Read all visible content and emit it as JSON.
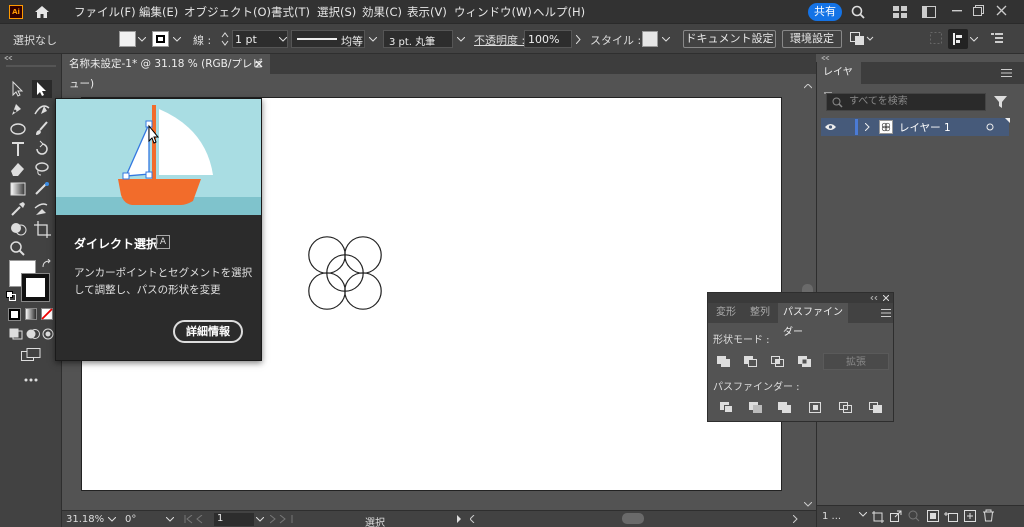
{
  "app": {
    "logo": "Ai"
  },
  "menu": [
    "ファイル(F)",
    "編集(E)",
    "オブジェクト(O)",
    "書式(T)",
    "選択(S)",
    "効果(C)",
    "表示(V)",
    "ウィンドウ(W)",
    "ヘルプ(H)"
  ],
  "share_label": "共有",
  "control": {
    "selection": "選択なし",
    "stroke_label": "線 :",
    "stroke_weight": "1 pt",
    "stroke_profile": "均等",
    "brush": "3 pt. 丸筆",
    "opacity_label": "不透明度 :",
    "opacity": "100%",
    "style_label": "スタイル :",
    "document_setup": "ドキュメント設定",
    "preferences": "環境設定"
  },
  "document_tab": "名称未設定-1* @ 31.18 % (RGB/プレビュー)",
  "tooltip": {
    "title": "ダイレクト選択",
    "shortcut": "A",
    "description": "アンカーポイントとセグメントを選択して調整し、パスの形状を変更",
    "more_button": "詳細情報"
  },
  "layers": {
    "tab": "レイヤー",
    "search_placeholder": "すべてを検索",
    "layer_name": "レイヤー 1",
    "footer_count": "1 ..."
  },
  "pathfinder": {
    "tabs": [
      "変形",
      "整列",
      "パスファインダー"
    ],
    "shape_modes_label": "形状モード :",
    "expand_label": "拡張",
    "pathfinders_label": "パスファインダー :"
  },
  "status": {
    "zoom": "31.18%",
    "rotation": "0°",
    "artboard_number": "1",
    "tool": "選択"
  },
  "colors": {
    "accent": "#1473e6",
    "layer_color": "#4b7bd6"
  }
}
